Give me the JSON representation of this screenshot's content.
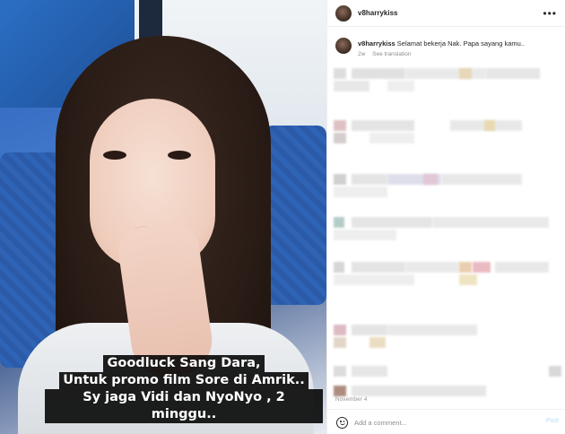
{
  "media": {
    "caption_lines": [
      "Goodluck Sang Dara,",
      "Untuk promo film Sore di Amrik..",
      "Sy jaga Vidi dan NyoNyo , 2 minggu.."
    ]
  },
  "header": {
    "username": "v8harrykiss",
    "more_icon": "ellipsis-icon"
  },
  "post_caption": {
    "username": "v8harrykiss",
    "text": "Selamat bekerja Nak. Papa sayang kamu..",
    "age": "2w",
    "see_translation": "See translation"
  },
  "date": "November 4",
  "footer": {
    "emoji_icon": "smile-icon",
    "placeholder": "Add a comment...",
    "post_label": "Post"
  },
  "colors": {
    "caption_bg": "#000000",
    "post_disabled": "#b2dffc",
    "muted": "#8e8e8e"
  }
}
